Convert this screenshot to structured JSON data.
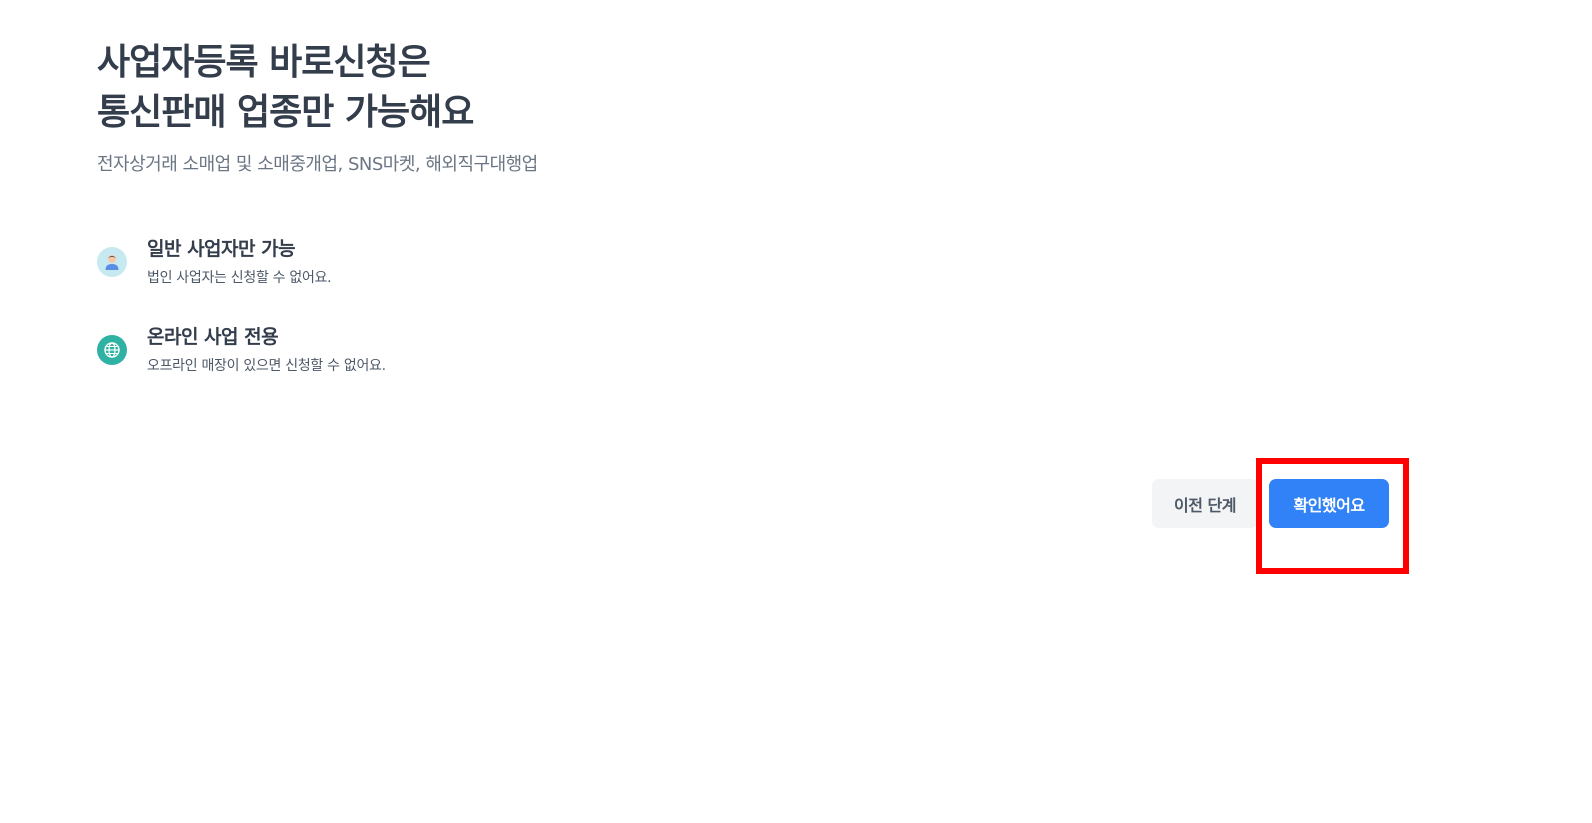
{
  "header": {
    "title_line1": "사업자등록 바로신청은",
    "title_line2": "통신판매 업종만 가능해요",
    "subtitle": "전자상거래 소매업 및 소매중개업, SNS마켓, 해외직구대행업"
  },
  "features": [
    {
      "icon": "person-icon",
      "title": "일반 사업자만 가능",
      "description": "법인 사업자는 신청할 수 없어요."
    },
    {
      "icon": "globe-icon",
      "title": "온라인 사업 전용",
      "description": "오프라인 매장이 있으면 신청할 수 없어요."
    }
  ],
  "actions": {
    "prev_label": "이전 단계",
    "confirm_label": "확인했어요"
  },
  "colors": {
    "primary": "#3182f6",
    "secondary_bg": "#f2f4f6",
    "text_primary": "#333d4b",
    "text_secondary": "#6b7684",
    "highlight": "#ff0000",
    "person_icon_bg": "#c7eaf2",
    "globe_icon_bg": "#2fb1a4"
  }
}
